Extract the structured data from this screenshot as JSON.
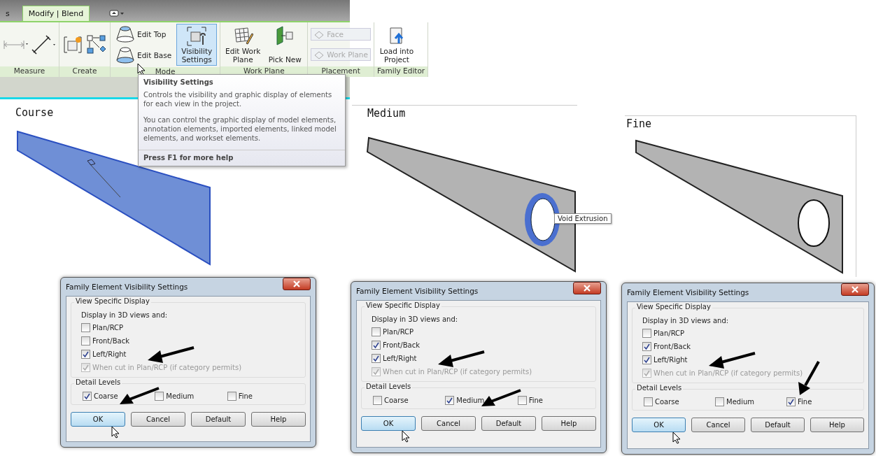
{
  "ribbon": {
    "tabs": [
      {
        "label": "s",
        "selected": false
      },
      {
        "label": "Modify | Blend",
        "selected": true
      }
    ],
    "panels": [
      {
        "label": "Measure",
        "tools": [
          {
            "kind": "icon"
          },
          {
            "kind": "icon"
          }
        ]
      },
      {
        "label": "Create",
        "tools": [
          {
            "kind": "icon"
          },
          {
            "kind": "icon"
          }
        ]
      },
      {
        "label": "Mode",
        "tools": [
          {
            "kind": "stack",
            "items": [
              {
                "label": "Edit Top",
                "disabled": false
              },
              {
                "label": "Edit Base",
                "disabled": false
              }
            ]
          },
          {
            "kind": "large",
            "label": "Visibility Settings",
            "selected": true
          }
        ]
      },
      {
        "label": "Work Plane",
        "tools": [
          {
            "kind": "large",
            "label": "Edit Work Plane",
            "selected": false
          },
          {
            "kind": "large",
            "label": "Pick New",
            "selected": false
          }
        ]
      },
      {
        "label": "Placement",
        "tools": [
          {
            "kind": "stack",
            "items": [
              {
                "label": "Face",
                "disabled": true
              },
              {
                "label": "Work Plane",
                "disabled": true
              }
            ]
          }
        ]
      },
      {
        "label": "Family Editor",
        "tools": [
          {
            "kind": "large",
            "label": "Load into Project",
            "selected": false
          }
        ]
      }
    ]
  },
  "tooltip": {
    "title": "Visibility Settings",
    "paragraphs": [
      "Controls the visibility and graphic display of elements for each view in the project.",
      "You can control the graphic display of model elements, annotation elements, imported elements, linked model elements, and workset elements."
    ],
    "footer": "Press F1 for more help"
  },
  "views": [
    {
      "label": "Course",
      "kind": "coarse"
    },
    {
      "label": "Medium",
      "kind": "medium",
      "hover_tip": "Void Extrusion"
    },
    {
      "label": "Fine",
      "kind": "fine"
    }
  ],
  "dialogs": [
    {
      "title": "Family Element Visibility Settings",
      "group": "View Specific Display",
      "subtitle": "Display in 3D views and:",
      "options": [
        {
          "label": "Plan/RCP",
          "checked": false,
          "disabled": false
        },
        {
          "label": "Front/Back",
          "checked": false,
          "disabled": false
        },
        {
          "label": "Left/Right",
          "checked": true,
          "disabled": false
        },
        {
          "label": "When cut in Plan/RCP (if category permits)",
          "checked": true,
          "disabled": true
        }
      ],
      "detail_group": "Detail Levels",
      "levels": [
        {
          "label": "Coarse",
          "checked": true
        },
        {
          "label": "Medium",
          "checked": false
        },
        {
          "label": "Fine",
          "checked": false
        }
      ],
      "buttons": [
        {
          "label": "OK",
          "focused": true
        },
        {
          "label": "Cancel",
          "focused": false
        },
        {
          "label": "Default",
          "focused": false
        },
        {
          "label": "Help",
          "focused": false
        }
      ]
    },
    {
      "title": "Family Element Visibility Settings",
      "group": "View Specific Display",
      "subtitle": "Display in 3D views and:",
      "options": [
        {
          "label": "Plan/RCP",
          "checked": false,
          "disabled": false
        },
        {
          "label": "Front/Back",
          "checked": true,
          "disabled": false
        },
        {
          "label": "Left/Right",
          "checked": true,
          "disabled": false
        },
        {
          "label": "When cut in Plan/RCP (if category permits)",
          "checked": true,
          "disabled": true
        }
      ],
      "detail_group": "Detail Levels",
      "levels": [
        {
          "label": "Coarse",
          "checked": false
        },
        {
          "label": "Medium",
          "checked": true
        },
        {
          "label": "Fine",
          "checked": false
        }
      ],
      "buttons": [
        {
          "label": "OK",
          "focused": true
        },
        {
          "label": "Cancel",
          "focused": false
        },
        {
          "label": "Default",
          "focused": false
        },
        {
          "label": "Help",
          "focused": false
        }
      ]
    },
    {
      "title": "Family Element Visibility Settings",
      "group": "View Specific Display",
      "subtitle": "Display in 3D views and:",
      "options": [
        {
          "label": "Plan/RCP",
          "checked": false,
          "disabled": false
        },
        {
          "label": "Front/Back",
          "checked": true,
          "disabled": false
        },
        {
          "label": "Left/Right",
          "checked": true,
          "disabled": false
        },
        {
          "label": "When cut in Plan/RCP (if category permits)",
          "checked": true,
          "disabled": true
        }
      ],
      "detail_group": "Detail Levels",
      "levels": [
        {
          "label": "Coarse",
          "checked": false
        },
        {
          "label": "Medium",
          "checked": false
        },
        {
          "label": "Fine",
          "checked": true
        }
      ],
      "buttons": [
        {
          "label": "OK",
          "focused": true
        },
        {
          "label": "Cancel",
          "focused": false
        },
        {
          "label": "Default",
          "focused": false
        },
        {
          "label": "Help",
          "focused": false
        }
      ]
    }
  ]
}
